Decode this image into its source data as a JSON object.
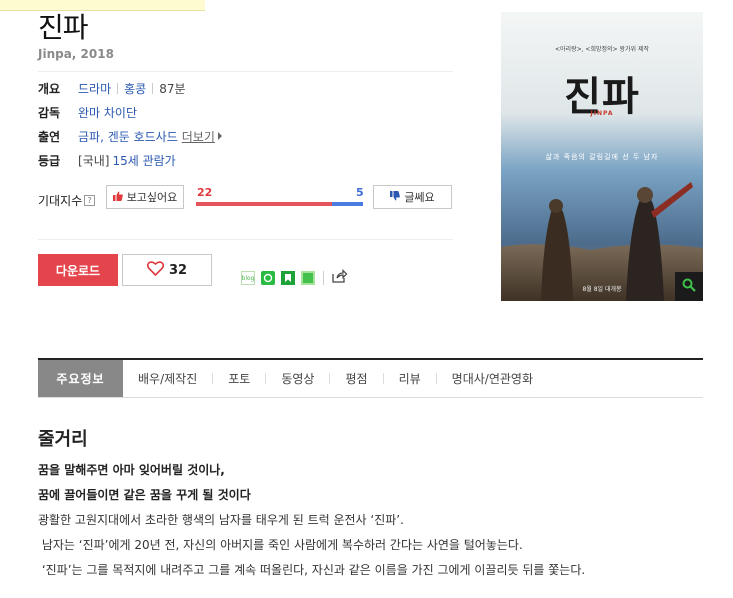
{
  "movie": {
    "title": "진파",
    "subtitle": "Jinpa, 2018"
  },
  "info": {
    "overview_label": "개요",
    "genre": "드라마",
    "country": "홍콩",
    "runtime": "87분",
    "director_label": "감독",
    "director": "완마 차이단",
    "cast_label": "출연",
    "cast": "금파, 겐둔 호드사드",
    "cast_more": "더보기",
    "rating_label": "등급",
    "rating_prefix": "[국내]",
    "rating": "15세 관람가"
  },
  "expectation": {
    "label": "기대지수",
    "help": "?",
    "want_label": "보고싶어요",
    "want_count": "22",
    "no_label": "글쎄요",
    "no_count": "5",
    "want_fraction": 0.815
  },
  "actions": {
    "download_label": "다운로드",
    "like_count": "32"
  },
  "share": {
    "blog_label": "blog"
  },
  "poster": {
    "credit": "<아리랑>, <희망정의> 왕가위 제작",
    "title": "진파",
    "title_en": "JINPA",
    "tagline": "삶과 죽음의 갈림길에 선 두 남자",
    "date": "8월 8일 대개봉"
  },
  "tabs": [
    {
      "label": "주요정보"
    },
    {
      "label": "배우/제작진"
    },
    {
      "label": "포토"
    },
    {
      "label": "동영상"
    },
    {
      "label": "평점"
    },
    {
      "label": "리뷰"
    },
    {
      "label": "명대사/연관영화"
    }
  ],
  "synopsis": {
    "title": "줄거리",
    "lines": [
      "꿈을 말해주면 아마 잊어버릴 것이나,",
      "꿈에 끌어들이면 같은 꿈을 꾸게 될 것이다",
      "광활한 고원지대에서 초라한 행색의 남자를 태우게 된 트럭 운전사 ‘진파’.",
      " 남자는 ‘진파’에게 20년 전, 자신의 아버지를 죽인 사람에게 복수하러 간다는 사연을 털어놓는다.",
      " ‘진파’는 그를 목적지에 내려주고 그를 계속 떠올린다, 자신과 같은 이름을 가진 그에게 이끌리듯 뒤를 쫓는다."
    ]
  },
  "colors": {
    "accent_red": "#e4454c",
    "link_blue": "#2b59b0",
    "vote_blue": "#3d6fd6"
  }
}
